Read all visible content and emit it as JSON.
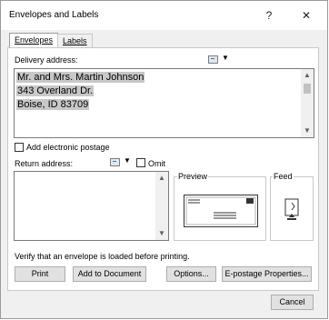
{
  "window": {
    "title": "Envelopes and Labels",
    "help": "?",
    "close": "✕"
  },
  "tabs": [
    {
      "label": "Envelopes",
      "active": true
    },
    {
      "label": "Labels",
      "active": false
    }
  ],
  "delivery": {
    "label": "Delivery address:",
    "lines": [
      "Mr. and Mrs. Martin Johnson",
      "343 Overland Dr.",
      "Boise, ID  83709"
    ],
    "addressbook_icon": "address-book-icon",
    "dropdown_icon": "caret-down-icon"
  },
  "postage": {
    "label": "Add electronic postage",
    "checked": false
  },
  "return": {
    "label": "Return address:",
    "omit_label": "Omit",
    "omit_checked": false,
    "value": ""
  },
  "preview": {
    "label": "Preview"
  },
  "feed": {
    "label": "Feed"
  },
  "verify_text": "Verify that an envelope is loaded before printing.",
  "buttons": {
    "print": "Print",
    "add_to_document": "Add to Document",
    "options": "Options...",
    "epostage": "E-postage Properties...",
    "cancel": "Cancel"
  },
  "colors": {
    "selection": "#c8c8c8",
    "dialog_bg": "#f0f0f0"
  }
}
